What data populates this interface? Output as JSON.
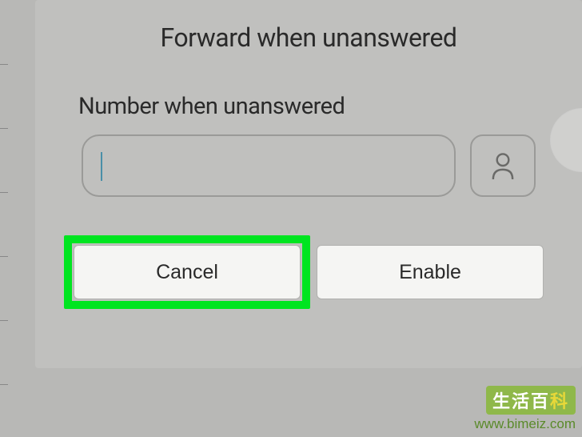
{
  "dialog": {
    "title": "Forward when unanswered",
    "field_label": "Number when unanswered",
    "input_value": "",
    "cancel_label": "Cancel",
    "enable_label": "Enable"
  },
  "watermark": {
    "cn_text_1": "生活百",
    "cn_text_2": "科",
    "url": "www.bimeiz.com"
  }
}
